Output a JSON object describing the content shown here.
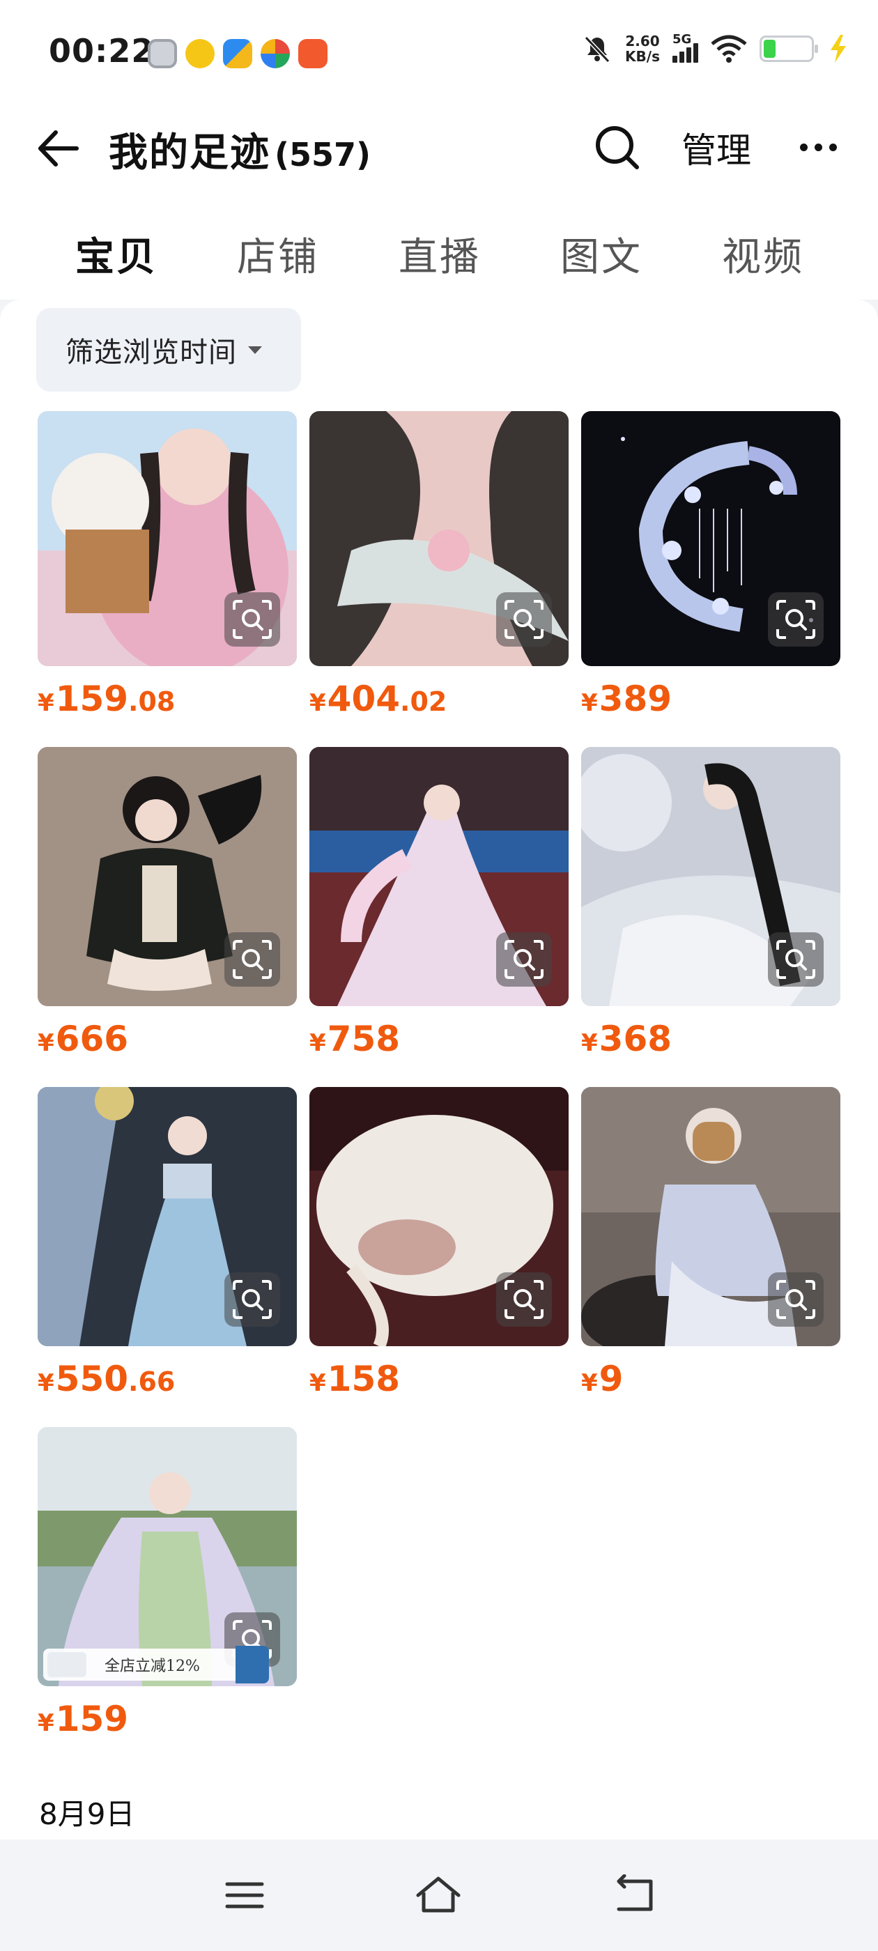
{
  "status_bar": {
    "time": "00:22",
    "app_icons": [
      "settings-app-icon",
      "yellow-app-icon",
      "files-app-icon",
      "browser-app-icon",
      "shop-app-icon"
    ],
    "net_speed_value": "2.60",
    "net_speed_unit": "KB/s",
    "network": "5G",
    "battery_percent": 25
  },
  "header": {
    "title": "我的足迹",
    "count": "(557)",
    "manage_label": "管理"
  },
  "tabs": [
    {
      "label": "宝贝",
      "active": true
    },
    {
      "label": "店铺",
      "active": false
    },
    {
      "label": "直播",
      "active": false
    },
    {
      "label": "图文",
      "active": false
    },
    {
      "label": "视频",
      "active": false
    }
  ],
  "filter": {
    "label": "筛选浏览时间"
  },
  "products": [
    {
      "currency": "¥",
      "price_int": "159",
      "price_dec": ".08"
    },
    {
      "currency": "¥",
      "price_int": "404",
      "price_dec": ".02"
    },
    {
      "currency": "¥",
      "price_int": "389",
      "price_dec": ""
    },
    {
      "currency": "¥",
      "price_int": "666",
      "price_dec": ""
    },
    {
      "currency": "¥",
      "price_int": "758",
      "price_dec": ""
    },
    {
      "currency": "¥",
      "price_int": "368",
      "price_dec": ""
    },
    {
      "currency": "¥",
      "price_int": "550",
      "price_dec": ".66"
    },
    {
      "currency": "¥",
      "price_int": "158",
      "price_dec": ""
    },
    {
      "currency": "¥",
      "price_int": "9",
      "price_dec": ""
    },
    {
      "currency": "¥",
      "price_int": "159",
      "price_dec": "",
      "promo_text": "全店立减12%"
    }
  ],
  "section_date": "8月9日",
  "colors": {
    "price": "#f05a0e",
    "accent_text": "#111111",
    "background": "#f3f4f7"
  }
}
